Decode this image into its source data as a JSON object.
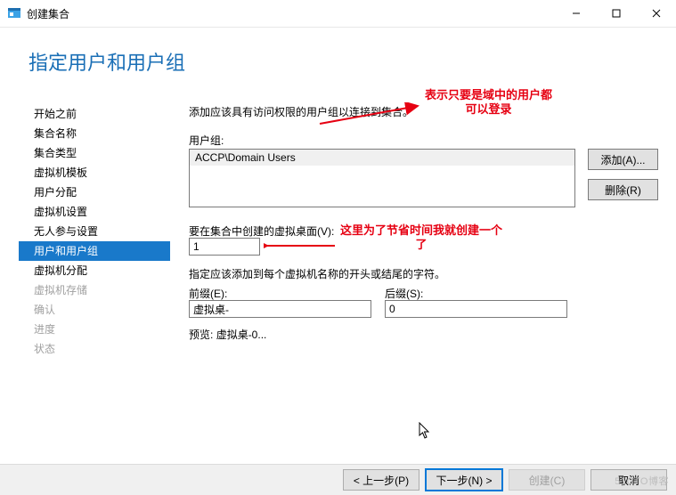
{
  "window": {
    "title": "创建集合"
  },
  "heading": "指定用户和用户组",
  "sidebar": {
    "items": [
      {
        "label": "开始之前",
        "state": "normal"
      },
      {
        "label": "集合名称",
        "state": "normal"
      },
      {
        "label": "集合类型",
        "state": "normal"
      },
      {
        "label": "虚拟机模板",
        "state": "normal"
      },
      {
        "label": "用户分配",
        "state": "normal"
      },
      {
        "label": "虚拟机设置",
        "state": "normal"
      },
      {
        "label": "无人参与设置",
        "state": "normal"
      },
      {
        "label": "用户和用户组",
        "state": "active"
      },
      {
        "label": "虚拟机分配",
        "state": "normal"
      },
      {
        "label": "虚拟机存储",
        "state": "disabled"
      },
      {
        "label": "确认",
        "state": "disabled"
      },
      {
        "label": "进度",
        "state": "disabled"
      },
      {
        "label": "状态",
        "state": "disabled"
      }
    ]
  },
  "content": {
    "intro": "添加应该具有访问权限的用户组以连接到集合。",
    "usergroup_label": "用户组:",
    "usergroup_items": [
      "ACCP\\Domain Users"
    ],
    "btn_add": "添加(A)...",
    "btn_del": "删除(R)",
    "vd_label": "要在集合中创建的虚拟桌面(V):",
    "vd_value": "1",
    "desc2": "指定应该添加到每个虚拟机名称的开头或结尾的字符。",
    "prefix_label": "前缀(E):",
    "prefix_value": "虚拟桌-",
    "suffix_label": "后缀(S):",
    "suffix_value": "0",
    "preview_label": "预览:",
    "preview_value": "虚拟桌-0..."
  },
  "annotations": {
    "a1_line1": "表示只要是域中的用户都",
    "a1_line2": "可以登录",
    "a2_line1": "这里为了节省时间我就创建一个",
    "a2_line2": "了"
  },
  "footer": {
    "prev": "< 上一步(P)",
    "next": "下一步(N) >",
    "create": "创建(C)",
    "cancel": "取消"
  },
  "watermark": "51CTO博客"
}
